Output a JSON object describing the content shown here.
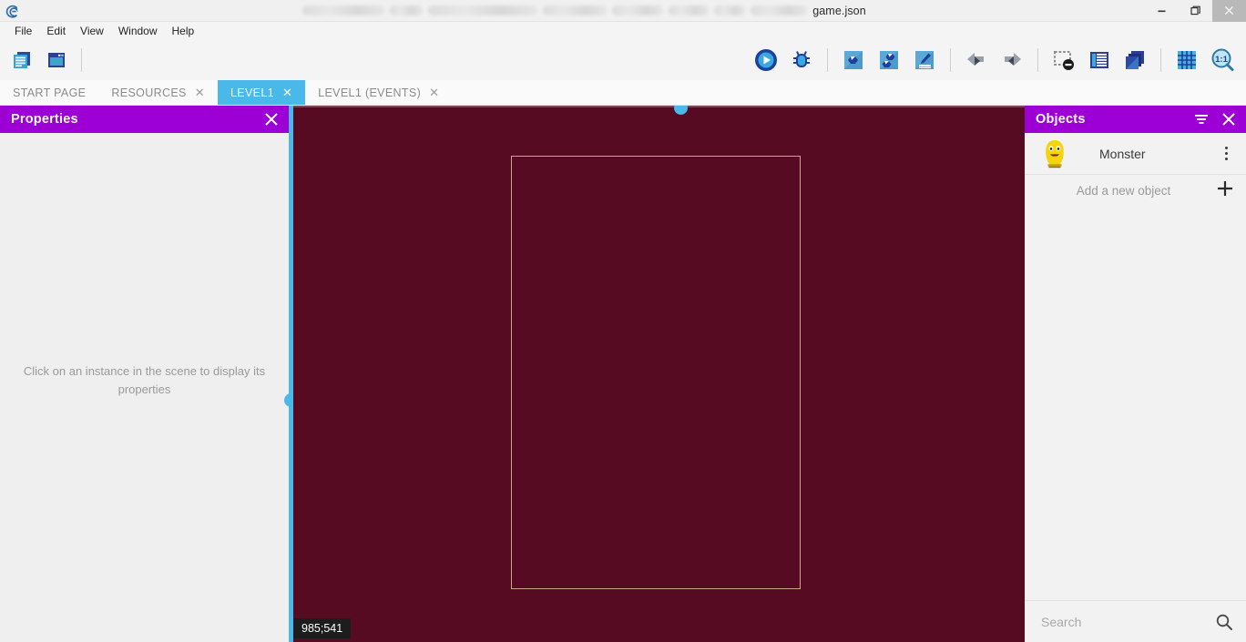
{
  "window": {
    "title_file": "game.json",
    "minimize_label": "—",
    "maximize_label": "❐",
    "close_label": "✕"
  },
  "menu": {
    "items": [
      {
        "label": "File"
      },
      {
        "label": "Edit"
      },
      {
        "label": "View"
      },
      {
        "label": "Window"
      },
      {
        "label": "Help"
      }
    ]
  },
  "toolbar": {
    "left": [
      {
        "name": "open-project-icon",
        "tooltip": "Open project"
      },
      {
        "name": "new-window-icon",
        "tooltip": "New window"
      }
    ],
    "right": [
      {
        "name": "preview-play-icon",
        "tooltip": "Preview"
      },
      {
        "name": "debug-bug-icon",
        "tooltip": "Debug"
      },
      {
        "name": "add-scene-icon",
        "tooltip": "Add scene"
      },
      {
        "name": "add-external-layout-icon",
        "tooltip": "Add external layout"
      },
      {
        "name": "add-external-events-icon",
        "tooltip": "Add external events"
      },
      {
        "name": "undo-icon",
        "tooltip": "Undo"
      },
      {
        "name": "redo-icon",
        "tooltip": "Redo"
      },
      {
        "name": "hide-grid-icon",
        "tooltip": "Hide grid"
      },
      {
        "name": "objects-panel-icon",
        "tooltip": "Objects panel"
      },
      {
        "name": "layers-panel-icon",
        "tooltip": "Layers panel"
      },
      {
        "name": "grid-icon",
        "tooltip": "Grid setup"
      },
      {
        "name": "zoom-one-to-one-icon",
        "tooltip": "Zoom 1:1"
      }
    ]
  },
  "tabs": [
    {
      "label": "START PAGE",
      "active": false,
      "closable": false
    },
    {
      "label": "RESOURCES",
      "active": false,
      "closable": true
    },
    {
      "label": "LEVEL1",
      "active": true,
      "closable": true
    },
    {
      "label": "LEVEL1 (EVENTS)",
      "active": false,
      "closable": true
    }
  ],
  "tab_close_glyph": "✕",
  "properties": {
    "title": "Properties",
    "close_glyph": "✕",
    "empty_message": "Click on an instance in the scene to display its properties"
  },
  "canvas": {
    "background_color": "#560b22",
    "scene_rect_border_color": "#c8a78d",
    "coordinates": "985;541",
    "handle_color": "#4ab8e8"
  },
  "objects": {
    "title": "Objects",
    "filter_glyph": "filter-icon",
    "close_glyph": "✕",
    "items": [
      {
        "name": "Monster",
        "thumb": "monster-sprite-icon"
      }
    ],
    "add_label": "Add a new object",
    "add_glyph": "＋",
    "search_placeholder": "Search",
    "search_value": ""
  },
  "colors": {
    "panel_header": "#9c00d4",
    "active_tab": "#4ab8e8",
    "accent_blue": "#4ab8e8"
  }
}
